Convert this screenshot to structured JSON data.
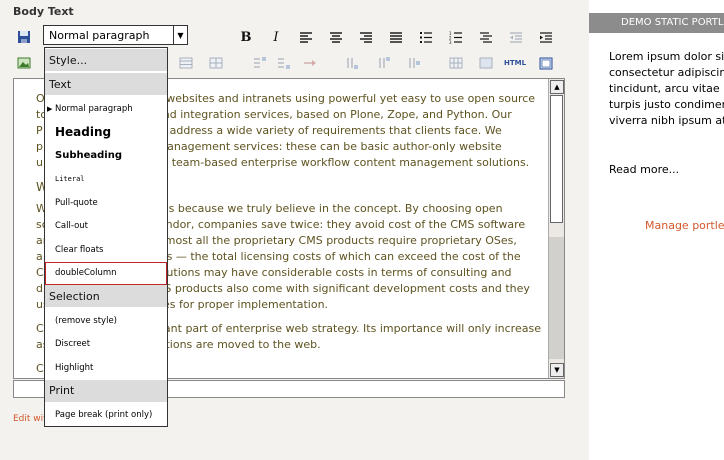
{
  "field": {
    "label": "Body Text",
    "edit_link": "Edit wit"
  },
  "toolbar": {
    "style_value": "Normal paragraph",
    "bold_label": "B",
    "italic_label": "I",
    "html_label": "HTML"
  },
  "dropdown": {
    "items": [
      {
        "kind": "header",
        "label": "Style..."
      },
      {
        "kind": "header",
        "label": "Text"
      },
      {
        "kind": "item",
        "label": "Normal paragraph",
        "current": true
      },
      {
        "kind": "item",
        "label": "Heading",
        "style": "heading"
      },
      {
        "kind": "item",
        "label": "Subheading",
        "style": "subheading"
      },
      {
        "kind": "item",
        "label": "Literal",
        "style": "literal"
      },
      {
        "kind": "item",
        "label": "Pull-quote"
      },
      {
        "kind": "item",
        "label": "Call-out"
      },
      {
        "kind": "item",
        "label": "Clear floats"
      },
      {
        "kind": "item",
        "label": "doubleColumn",
        "selected": true
      },
      {
        "kind": "header",
        "label": "Selection"
      },
      {
        "kind": "item",
        "label": "(remove style)"
      },
      {
        "kind": "item",
        "label": "Discreet"
      },
      {
        "kind": "item",
        "label": "Highlight"
      },
      {
        "kind": "header",
        "label": "Print"
      },
      {
        "kind": "item",
        "label": "Page break (print only)"
      }
    ]
  },
  "editor": {
    "p1_lines": [
      "O                         uality websites and intranets using powerful yet easy to use open source",
      "to                         ent and integration services, based on Plone, Zope, and Python. Our",
      "P                          rvices address a wide variety of requirements that clients face. We",
      "pr                         ent management services: these can be basic author-only website",
      "up                         cated team-based enterprise workflow content management solutions."
    ],
    "heading": "W",
    "p2_lines": [
      "W                        olutions because we truly believe in the concept. By choosing open",
      "so                        MS vendor, companies save twice: they avoid cost of the CMS software",
      "ar                         es (almost all the proprietary CMS products require proprietary OSes,",
      "a                          abases — the total licensing costs of which can exceed the cost of the",
      "C                          ce solutions may have considerable costs in terms of consulting and",
      "d                          al CMS products also come with significant development costs and they",
      "us                         ervices for proper implementation."
    ],
    "p3_lines": [
      "C                        important part of enterprise web strategy. Its importance will only increase",
      "as                        s functions are moved to the web."
    ],
    "last": "C"
  },
  "sidebar": {
    "portlet_title": "DEMO STATIC PORTLET",
    "body_lines": [
      "Lorem ipsum dolor sit ar",
      "consectetur adipiscing e",
      "tincidunt, arcu vitae lacin",
      "turpis justo condimentum",
      "viverra nibh ipsum at lor"
    ],
    "read_more": "Read more...",
    "manage": "Manage portlets"
  },
  "colors": {
    "accent": "#d2582c",
    "editor_text": "#5e5320",
    "portlet_header": "#8c8c8c"
  }
}
